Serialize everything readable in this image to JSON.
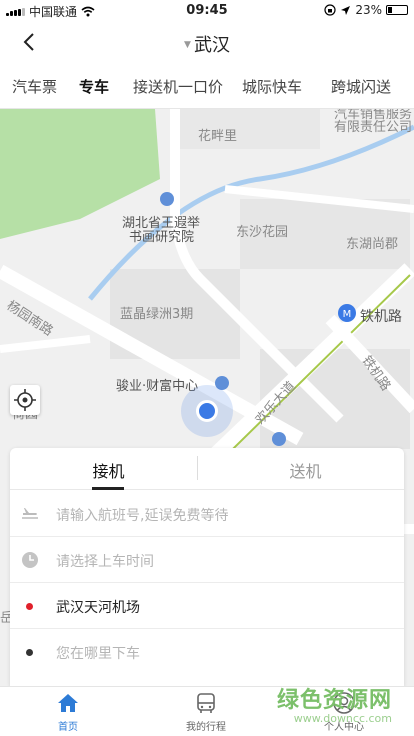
{
  "status_bar": {
    "carrier": "中国联通",
    "time": "09:45",
    "battery_percent": "23%",
    "battery_level": 0.23
  },
  "nav": {
    "title": "武汉",
    "back_icon": "chevron-left-icon",
    "title_icon": "caret-down-icon"
  },
  "tabs": [
    {
      "label": "汽车票",
      "active": false
    },
    {
      "label": "专车",
      "active": true
    },
    {
      "label": "接送机一口价",
      "active": false
    },
    {
      "label": "城际快车",
      "active": false
    },
    {
      "label": "跨城闪送",
      "active": false
    }
  ],
  "map": {
    "labels": [
      "汽车销售服务",
      "有限责任公司",
      "花畔里",
      "湖北省王遐举",
      "书画研究院",
      "东沙花园",
      "东湖尚郡",
      "杨园南路",
      "蓝晶绿洲3期",
      "铁机路",
      "铁机路",
      "骏业·财富中心",
      "欢乐大道",
      "倚园",
      "岳"
    ],
    "colors": {
      "road": "#ffffff",
      "park": "#b6e0a6",
      "river": "#a9cdf0",
      "metro": "#3b7ae5",
      "highway_line": "#a6c84a"
    }
  },
  "booking_panel": {
    "segments": [
      {
        "label": "接机",
        "active": true
      },
      {
        "label": "送机",
        "active": false
      }
    ],
    "rows": [
      {
        "icon": "airplane-icon",
        "text": "请输入航班号,延误免费等待",
        "filled": false
      },
      {
        "icon": "clock-icon",
        "text": "请选择上车时间",
        "filled": false
      },
      {
        "icon": "red-dot-icon",
        "text": "武汉天河机场",
        "filled": true,
        "dot_color": "#e0202b"
      },
      {
        "icon": "black-dot-icon",
        "text": "您在哪里下车",
        "filled": false,
        "dot_color": "#333333"
      }
    ]
  },
  "bottom_nav": {
    "items": [
      {
        "label": "首页",
        "icon": "home-icon",
        "active": true
      },
      {
        "label": "我的行程",
        "icon": "bus-icon",
        "active": false
      },
      {
        "label": "个人中心",
        "icon": "person-icon",
        "active": false
      }
    ],
    "active_color": "#2d7bd6"
  },
  "watermark": {
    "text": "绿色资源网",
    "url": "www.downcc.com"
  }
}
